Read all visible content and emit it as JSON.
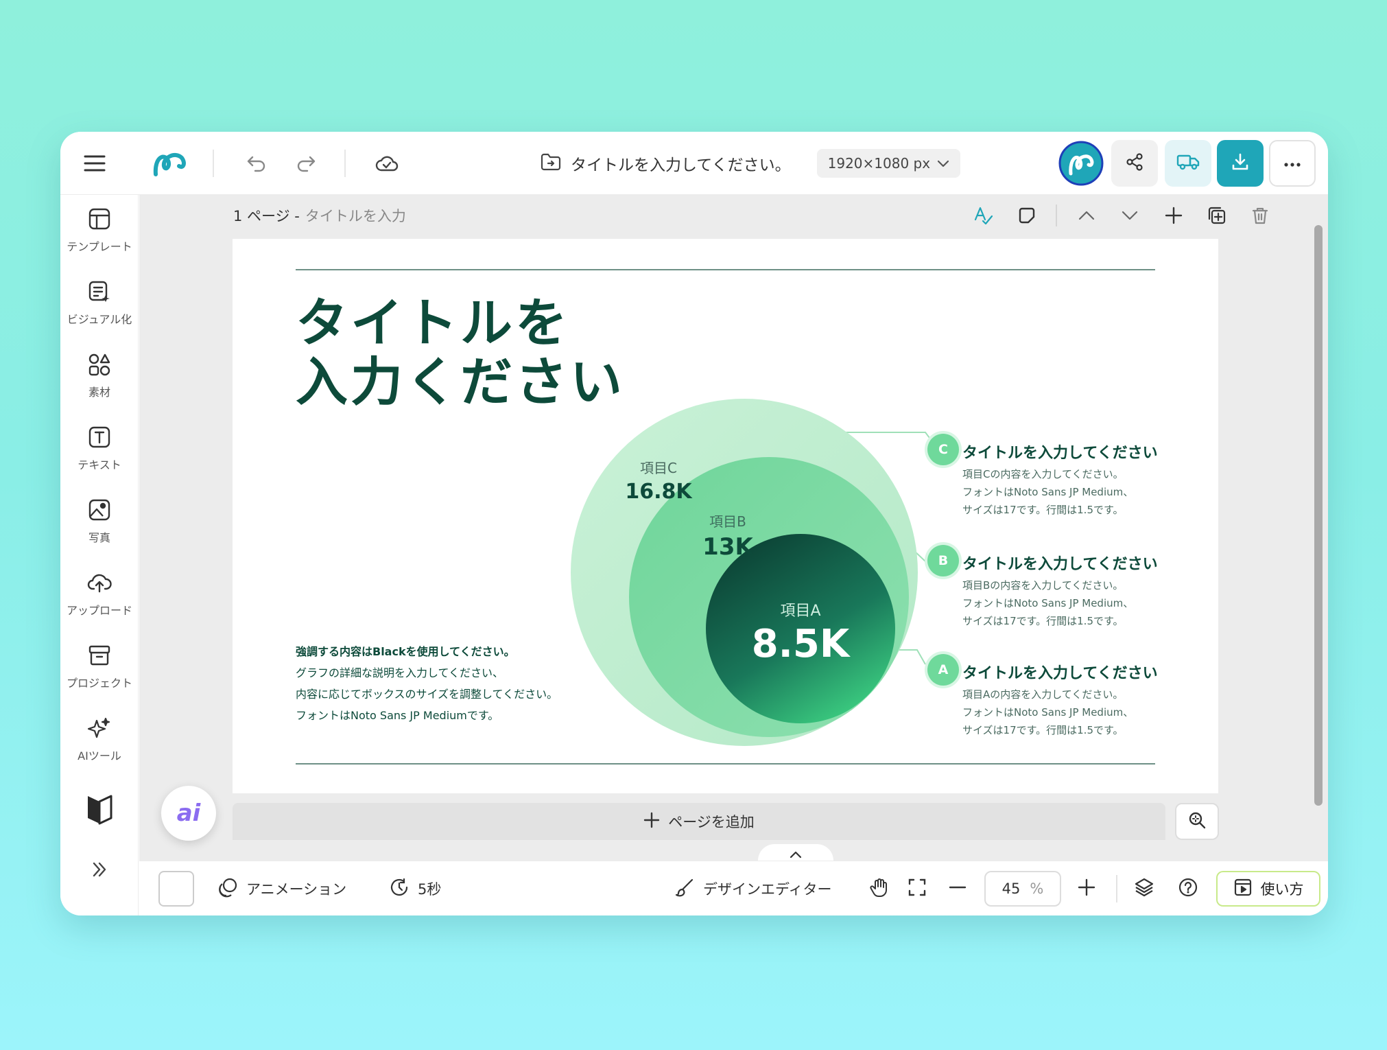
{
  "topbar": {
    "doc_title": "タイトルを入力してください。",
    "canvas_size": "1920×1080 px",
    "icons": {
      "menu": "hamburger-menu-icon",
      "logo": "logo-swirl",
      "undo": "undo-icon",
      "redo": "redo-icon",
      "save": "cloud-check-icon",
      "folder": "folder-move-icon",
      "share": "share-icon",
      "truck": "truck-icon",
      "download": "download-icon",
      "more": "more-icon"
    },
    "colors": {
      "brand": "#1fa6b8",
      "download_bg": "#1fa6b8",
      "truck_bg": "#e3f4f7"
    }
  },
  "sidebar": {
    "items": [
      {
        "label": "テンプレート",
        "icon": "template-icon"
      },
      {
        "label": "ビジュアル化",
        "icon": "visualize-icon"
      },
      {
        "label": "素材",
        "icon": "elements-icon"
      },
      {
        "label": "テキスト",
        "icon": "text-icon"
      },
      {
        "label": "写真",
        "icon": "photo-icon"
      },
      {
        "label": "アップロード",
        "icon": "upload-icon"
      },
      {
        "label": "プロジェクト",
        "icon": "project-icon"
      },
      {
        "label": "AIツール",
        "icon": "ai-tools-icon"
      }
    ]
  },
  "page_header": {
    "page": "1 ページ -",
    "page_title": "タイトルを入力"
  },
  "slide": {
    "title": "タイトルを\n入力ください",
    "desc_bold": "強調する内容はBlackを使用してください。",
    "desc_lines": [
      "グラフの詳細な説明を入力してください、",
      "内容に応じてボックスのサイズを調整してください。",
      "フォントはNoto Sans JP Mediumです。"
    ],
    "circles": [
      {
        "label": "項目C",
        "value": "16.8K",
        "color": "#bdeccd"
      },
      {
        "label": "項目B",
        "value": "13K",
        "color": "#72d79c"
      },
      {
        "label": "項目A",
        "value": "8.5K",
        "color": "#0f4c3b"
      }
    ],
    "callouts": [
      {
        "badge": "C",
        "title": "タイトルを入力してください",
        "lines": [
          "項目Cの内容を入力してください。",
          "フォントはNoto Sans JP Medium、",
          "サイズは17です。行間は1.5です。"
        ]
      },
      {
        "badge": "B",
        "title": "タイトルを入力してください",
        "lines": [
          "項目Bの内容を入力してください。",
          "フォントはNoto Sans JP Medium、",
          "サイズは17です。行間は1.5です。"
        ]
      },
      {
        "badge": "A",
        "title": "タイトルを入力してください",
        "lines": [
          "項目Aの内容を入力してください。",
          "フォントはNoto Sans JP Medium、",
          "サイズは17です。行間は1.5です。"
        ]
      }
    ]
  },
  "canvas": {
    "add_page": "ページを追加",
    "ai_button": "ai"
  },
  "bottombar": {
    "animation": "アニメーション",
    "duration": "5秒",
    "design_editor": "デザインエディター",
    "zoom": "45",
    "zoom_unit": "%",
    "howto": "使い方"
  }
}
